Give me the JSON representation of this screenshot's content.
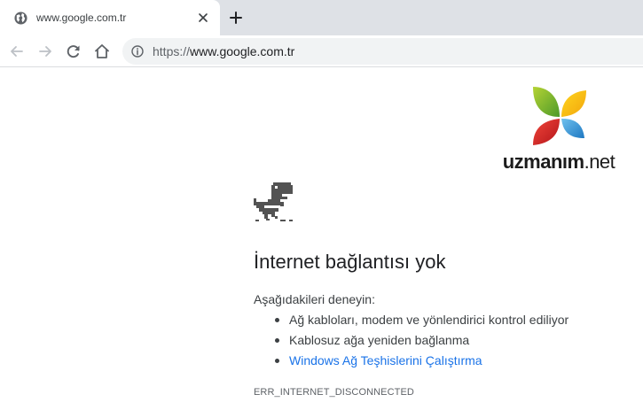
{
  "tab": {
    "title": "www.google.com.tr",
    "favicon": "globe-icon",
    "close_icon": "close-icon"
  },
  "tabstrip": {
    "new_tab_icon": "plus-icon"
  },
  "toolbar": {
    "back_icon": "arrow-left-icon",
    "forward_icon": "arrow-right-icon",
    "reload_icon": "reload-icon",
    "home_icon": "home-icon",
    "security_icon": "info-icon",
    "url_scheme": "https://",
    "url_host": "www.google.com.tr"
  },
  "watermark": {
    "brand": "uzmanım",
    "suffix": ".net",
    "colors": [
      "#8cc63f",
      "#f7c21d",
      "#e7282d",
      "#2e9bd8"
    ]
  },
  "error": {
    "icon": "dinosaur-icon",
    "title": "İnternet bağlantısı yok",
    "intro": "Aşağıdakileri deneyin:",
    "suggestions": [
      "Ağ kabloları, modem ve yönlendirici kontrol ediliyor",
      "Kablosuz ağa yeniden bağlanma"
    ],
    "diagnostics_link": "Windows Ağ Teşhislerini Çalıştırma",
    "code": "ERR_INTERNET_DISCONNECTED"
  },
  "colors": {
    "tabstrip_bg": "#dee1e6",
    "omnibox_bg": "#f1f3f4",
    "link": "#1a73e8"
  }
}
